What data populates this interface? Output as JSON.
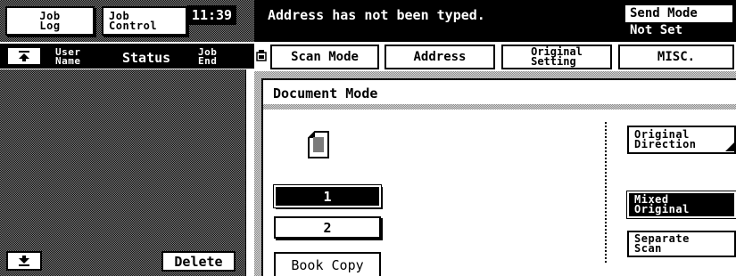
{
  "left_header": {
    "job_log_label": [
      "Job",
      "Log"
    ],
    "job_control_label": [
      "Job",
      "Control"
    ],
    "clock": "11:39"
  },
  "job_list": {
    "columns": {
      "user_name": [
        "User",
        "Name"
      ],
      "status": "Status",
      "job_end": [
        "Job",
        "End"
      ]
    },
    "delete_label": "Delete"
  },
  "message_bar": {
    "message": "Address has not been typed."
  },
  "send_mode": {
    "label": "Send Mode",
    "value": "Not Set"
  },
  "tabs": [
    {
      "label": "Scan Mode"
    },
    {
      "label": "Address"
    },
    {
      "label_lines": [
        "Original",
        "Setting"
      ]
    },
    {
      "label": "MISC."
    }
  ],
  "panel": {
    "title": "Document Mode",
    "mode_buttons": [
      "1",
      "2",
      "Book Copy"
    ],
    "right_buttons": {
      "original_direction": [
        "Original",
        "Direction"
      ],
      "mixed_original": [
        "Mixed",
        "Original"
      ],
      "separate_scan": [
        "Separate",
        "Scan"
      ]
    }
  },
  "icons": {
    "scroll_up": "up-arrow-icon",
    "scroll_down": "down-arrow-icon",
    "tab_marker": "panel-icon",
    "document": "document-icon"
  }
}
